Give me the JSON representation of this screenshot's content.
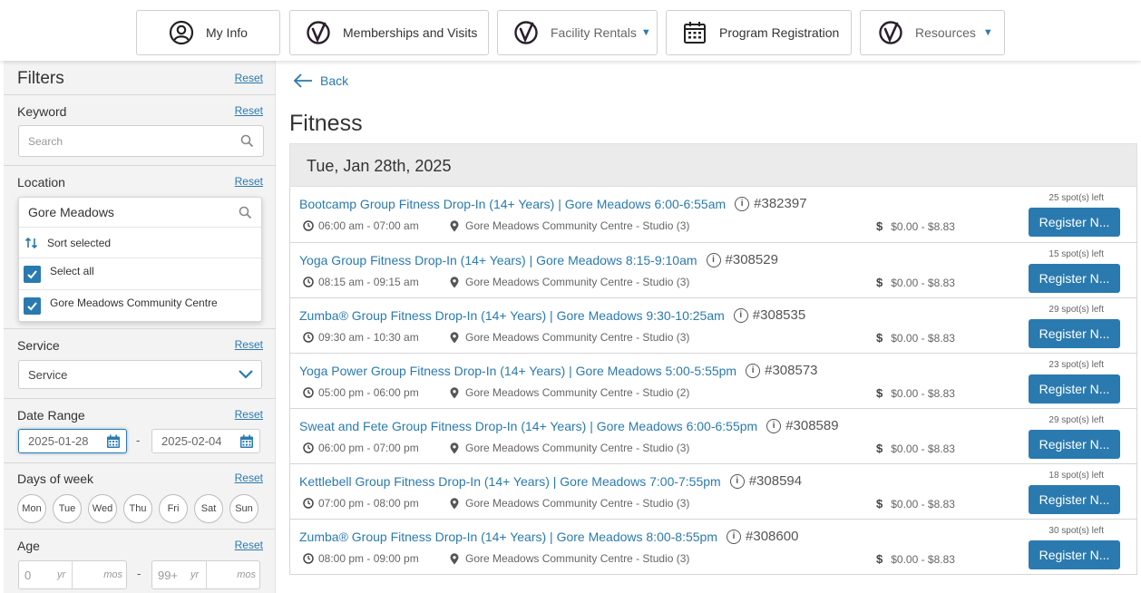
{
  "nav": {
    "my_info": "My Info",
    "memberships": "Memberships and Visits",
    "facility_rentals": "Facility Rentals",
    "program_registration": "Program Registration",
    "resources": "Resources"
  },
  "filters": {
    "title": "Filters",
    "reset": "Reset",
    "keyword": {
      "label": "Keyword",
      "placeholder": "Search"
    },
    "location": {
      "label": "Location",
      "value": "Gore Meadows",
      "sort_selected": "Sort selected",
      "select_all": "Select all",
      "options": [
        "Gore Meadows Community Centre"
      ]
    },
    "service": {
      "label": "Service",
      "value": "Service"
    },
    "date_range": {
      "label": "Date Range",
      "from": "2025-01-28",
      "to": "2025-02-04",
      "separator": "-"
    },
    "days": {
      "label": "Days of week",
      "items": [
        "Mon",
        "Tue",
        "Wed",
        "Thu",
        "Fri",
        "Sat",
        "Sun"
      ]
    },
    "age": {
      "label": "Age",
      "min_yr": "0",
      "max_yr": "99+",
      "yr": "yr",
      "mos": "mos",
      "separator": "-"
    }
  },
  "main": {
    "back": "Back",
    "title": "Fitness",
    "date_heading": "Tue, Jan 28th, 2025",
    "register_label": "Register N...",
    "programs": [
      {
        "title": "Bootcamp Group Fitness Drop-In (14+ Years) | Gore Meadows 6:00-6:55am",
        "number": "#382397",
        "time": "06:00 am - 07:00 am",
        "location": "Gore Meadows Community Centre - Studio (3)",
        "price": "$0.00 - $8.83",
        "spots": "25 spot(s) left"
      },
      {
        "title": "Yoga Group Fitness Drop-In (14+ Years) | Gore Meadows 8:15-9:10am",
        "number": "#308529",
        "time": "08:15 am - 09:15 am",
        "location": "Gore Meadows Community Centre - Studio (3)",
        "price": "$0.00 - $8.83",
        "spots": "15 spot(s) left"
      },
      {
        "title": "Zumba® Group Fitness Drop-In (14+ Years) | Gore Meadows 9:30-10:25am",
        "number": "#308535",
        "time": "09:30 am - 10:30 am",
        "location": "Gore Meadows Community Centre - Studio (3)",
        "price": "$0.00 - $8.83",
        "spots": "29 spot(s) left"
      },
      {
        "title": "Yoga Power Group Fitness Drop-In (14+ Years) | Gore Meadows 5:00-5:55pm",
        "number": "#308573",
        "time": "05:00 pm - 06:00 pm",
        "location": "Gore Meadows Community Centre - Studio (2)",
        "price": "$0.00 - $8.83",
        "spots": "23 spot(s) left"
      },
      {
        "title": "Sweat and Fete Group Fitness Drop-In (14+ Years) | Gore Meadows 6:00-6:55pm",
        "number": "#308589",
        "time": "06:00 pm - 07:00 pm",
        "location": "Gore Meadows Community Centre - Studio (3)",
        "price": "$0.00 - $8.83",
        "spots": "29 spot(s) left"
      },
      {
        "title": "Kettlebell Group Fitness Drop-In (14+ Years) | Gore Meadows 7:00-7:55pm",
        "number": "#308594",
        "time": "07:00 pm - 08:00 pm",
        "location": "Gore Meadows Community Centre - Studio (3)",
        "price": "$0.00 - $8.83",
        "spots": "18 spot(s) left"
      },
      {
        "title": "Zumba® Group Fitness Drop-In (14+ Years) | Gore Meadows 8:00-8:55pm",
        "number": "#308600",
        "time": "08:00 pm - 09:00 pm",
        "location": "Gore Meadows Community Centre - Studio (3)",
        "price": "$0.00 - $8.83",
        "spots": "30 spot(s) left"
      }
    ]
  },
  "colors": {
    "accent": "#2a7ab0",
    "sidebar_bg": "#f3f3f3",
    "header_bg": "#ebebeb"
  }
}
